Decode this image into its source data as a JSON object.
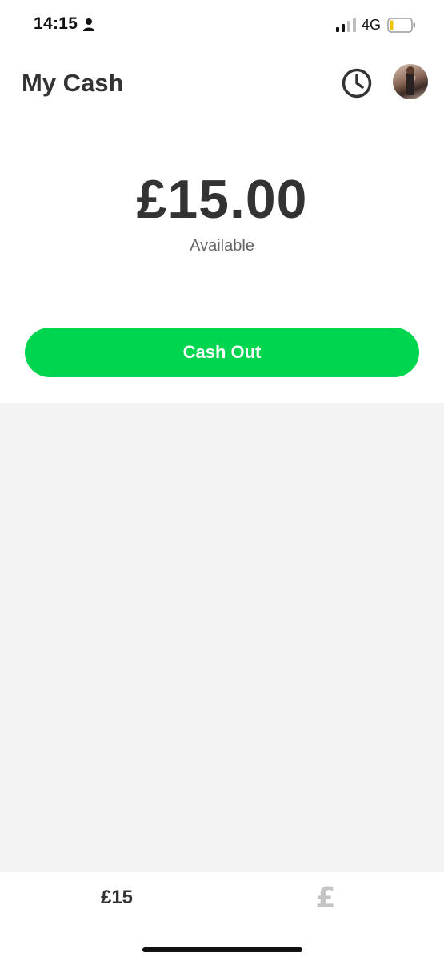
{
  "status_bar": {
    "time": "14:15",
    "network": "4G",
    "icons": [
      "person-icon",
      "signal-icon",
      "battery-icon"
    ]
  },
  "header": {
    "title": "My Cash",
    "history_icon": "clock-icon",
    "avatar_icon": "profile-avatar"
  },
  "balance": {
    "amount": "£15.00",
    "caption": "Available"
  },
  "actions": {
    "cash_out_label": "Cash Out"
  },
  "bottom_nav": {
    "balance_tab_label": "£15",
    "pay_tab_label": "£"
  },
  "colors": {
    "accent": "#00d54f",
    "text": "#333333",
    "content_bg": "#f3f3f3",
    "inactive_tab": "#c4c4c4"
  }
}
